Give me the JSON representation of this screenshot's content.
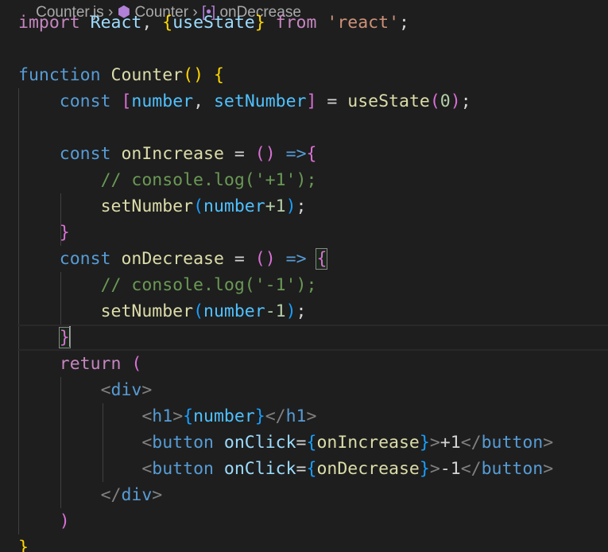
{
  "breadcrumb": {
    "file": "Counter.js",
    "symbol": "Counter",
    "member": "onDecrease"
  },
  "colors": {
    "background": "#1e1e1e",
    "keyword": "#569cd6",
    "control_keyword": "#c586c0",
    "function": "#dcdcaa",
    "variable": "#9cdcfe",
    "string": "#ce9178",
    "number": "#b5cea8",
    "comment": "#6a9955",
    "tag_bracket": "#808080",
    "bracket_level1": "#ffd700",
    "bracket_level2": "#da70d6",
    "bracket_level3": "#179fff"
  },
  "editor": {
    "language": "javascript",
    "current_line": 12,
    "lines": [
      "import React, {useState} from 'react';",
      "",
      "function Counter() {",
      "    const [number, setNumber] = useState(0);",
      "",
      "    const onIncrease = () =>{",
      "        // console.log('+1');",
      "        setNumber(number+1);",
      "    }",
      "    const onDecrease = () => {",
      "        // console.log('-1');",
      "        setNumber(number-1);",
      "    }",
      "    return (",
      "        <div>",
      "            <h1>{number}</h1>",
      "            <button onClick={onIncrease}>+1</button>",
      "            <button onClick={onDecrease}>-1</button>",
      "        </div>",
      "    )",
      "}"
    ],
    "tokens": {
      "l1": [
        "import",
        " ",
        "React",
        ", ",
        "{",
        "useState",
        "}",
        " ",
        "from",
        " ",
        "'react'",
        ";"
      ],
      "l3": [
        "function",
        " ",
        "Counter",
        "(",
        ")",
        " ",
        "{"
      ],
      "l4": [
        "    ",
        "const",
        " ",
        "[",
        "number",
        ", ",
        "setNumber",
        "]",
        " = ",
        "useState",
        "(",
        "0",
        ")",
        ";"
      ],
      "l6": [
        "    ",
        "const",
        " ",
        "onIncrease",
        " = ",
        "(",
        ")",
        " ",
        "=>",
        "{"
      ],
      "l7": [
        "        ",
        "// console.log('+1');"
      ],
      "l8": [
        "        ",
        "setNumber",
        "(",
        "number",
        "+1",
        ")",
        ";"
      ],
      "l9": [
        "    ",
        "}"
      ],
      "l10": [
        "    ",
        "const",
        " ",
        "onDecrease",
        " = ",
        "(",
        ")",
        " ",
        "=>",
        " ",
        "{"
      ],
      "l11": [
        "        ",
        "// console.log('-1');"
      ],
      "l12": [
        "        ",
        "setNumber",
        "(",
        "number",
        "-1",
        ")",
        ";"
      ],
      "l13": [
        "    ",
        "}"
      ],
      "l14": [
        "    ",
        "return",
        " ",
        "("
      ],
      "l15": [
        "        ",
        "<",
        "div",
        ">"
      ],
      "l16": [
        "            ",
        "<",
        "h1",
        ">",
        "{",
        "number",
        "}",
        "</",
        "h1",
        ">"
      ],
      "l17": [
        "            ",
        "<",
        "button",
        " ",
        "onClick",
        "=",
        "{",
        "onIncrease",
        "}",
        ">",
        "+1",
        "</",
        "button",
        ">"
      ],
      "l18": [
        "            ",
        "<",
        "button",
        " ",
        "onClick",
        "=",
        "{",
        "onDecrease",
        "}",
        ">",
        "-1",
        "</",
        "button",
        ">"
      ],
      "l19": [
        "        ",
        "</",
        "div",
        ">"
      ],
      "l20": [
        "    ",
        ")"
      ],
      "l21": [
        "}"
      ]
    }
  }
}
